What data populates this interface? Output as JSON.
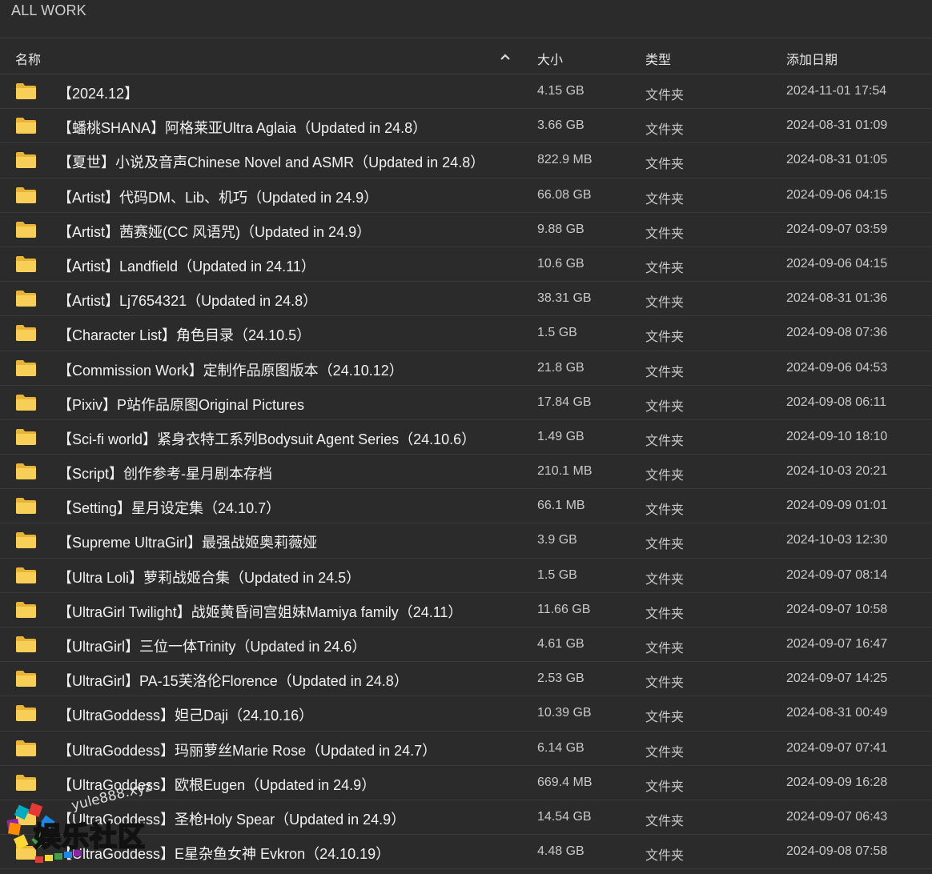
{
  "page": {
    "title": "ALL WORK"
  },
  "columns": {
    "name": "名称",
    "size": "大小",
    "type": "类型",
    "date": "添加日期"
  },
  "colors": {
    "background": "#2b2b2b",
    "folder_icon": "#f5c542",
    "text": "#f1f1f1",
    "muted": "#c9c9c9"
  },
  "icons": {
    "row_icon": "folder-icon",
    "sort": "sort-ascending-icon"
  },
  "rows": [
    {
      "name": "【2024.12】",
      "size": "4.15 GB",
      "type": "文件夹",
      "date": "2024-11-01 17:54"
    },
    {
      "name": "【蟠桃SHANA】阿格莱亚Ultra Aglaia（Updated in 24.8）",
      "size": "3.66 GB",
      "type": "文件夹",
      "date": "2024-08-31 01:09"
    },
    {
      "name": "【夏世】小说及音声Chinese Novel and ASMR（Updated in 24.8）",
      "size": "822.9 MB",
      "type": "文件夹",
      "date": "2024-08-31 01:05"
    },
    {
      "name": "【Artist】代码DM、Lib、机巧（Updated in 24.9）",
      "size": "66.08 GB",
      "type": "文件夹",
      "date": "2024-09-06 04:15"
    },
    {
      "name": "【Artist】茜赛娅(CC 风语咒)（Updated in 24.9）",
      "size": "9.88 GB",
      "type": "文件夹",
      "date": "2024-09-07 03:59"
    },
    {
      "name": "【Artist】Landfield（Updated in 24.11）",
      "size": "10.6 GB",
      "type": "文件夹",
      "date": "2024-09-06 04:15"
    },
    {
      "name": "【Artist】Lj7654321（Updated in 24.8）",
      "size": "38.31 GB",
      "type": "文件夹",
      "date": "2024-08-31 01:36"
    },
    {
      "name": "【Character List】角色目录（24.10.5）",
      "size": "1.5 GB",
      "type": "文件夹",
      "date": "2024-09-08 07:36"
    },
    {
      "name": "【Commission Work】定制作品原图版本（24.10.12）",
      "size": "21.8 GB",
      "type": "文件夹",
      "date": "2024-09-06 04:53"
    },
    {
      "name": "【Pixiv】P站作品原图Original Pictures",
      "size": "17.84 GB",
      "type": "文件夹",
      "date": "2024-09-08 06:11"
    },
    {
      "name": "【Sci-fi world】紧身衣特工系列Bodysuit Agent Series（24.10.6）",
      "size": "1.49 GB",
      "type": "文件夹",
      "date": "2024-09-10 18:10"
    },
    {
      "name": "【Script】创作参考-星月剧本存档",
      "size": "210.1 MB",
      "type": "文件夹",
      "date": "2024-10-03 20:21"
    },
    {
      "name": "【Setting】星月设定集（24.10.7）",
      "size": "66.1 MB",
      "type": "文件夹",
      "date": "2024-09-09 01:01"
    },
    {
      "name": "【Supreme UltraGirl】最强战姬奥莉薇娅",
      "size": "3.9 GB",
      "type": "文件夹",
      "date": "2024-10-03 12:30"
    },
    {
      "name": "【Ultra Loli】萝莉战姬合集（Updated in 24.5）",
      "size": "1.5 GB",
      "type": "文件夹",
      "date": "2024-09-07 08:14"
    },
    {
      "name": "【UltraGirl Twilight】战姬黄昏间宫姐妹Mamiya family（24.11）",
      "size": "11.66 GB",
      "type": "文件夹",
      "date": "2024-09-07 10:58"
    },
    {
      "name": "【UltraGirl】三位一体Trinity（Updated in 24.6）",
      "size": "4.61 GB",
      "type": "文件夹",
      "date": "2024-09-07 16:47"
    },
    {
      "name": "【UltraGirl】PA-15芙洛伦Florence（Updated in 24.8）",
      "size": "2.53 GB",
      "type": "文件夹",
      "date": "2024-09-07 14:25"
    },
    {
      "name": "【UltraGoddess】妲己Daji（24.10.16）",
      "size": "10.39 GB",
      "type": "文件夹",
      "date": "2024-08-31 00:49"
    },
    {
      "name": "【UltraGoddess】玛丽萝丝Marie Rose（Updated in 24.7）",
      "size": "6.14 GB",
      "type": "文件夹",
      "date": "2024-09-07 07:41"
    },
    {
      "name": "【UltraGoddess】欧根Eugen（Updated in 24.9）",
      "size": "669.4 MB",
      "type": "文件夹",
      "date": "2024-09-09 16:28"
    },
    {
      "name": "【UltraGoddess】圣枪Holy Spear（Updated in 24.9）",
      "size": "14.54 GB",
      "type": "文件夹",
      "date": "2024-09-07 06:43"
    },
    {
      "name": "【UltraGoddess】E星杂鱼女神 Evkron（24.10.19）",
      "size": "4.48 GB",
      "type": "文件夹",
      "date": "2024-09-08 07:58"
    }
  ],
  "watermark": {
    "url_text": "yule888.xyz",
    "cn_text": "娱乐社区"
  }
}
